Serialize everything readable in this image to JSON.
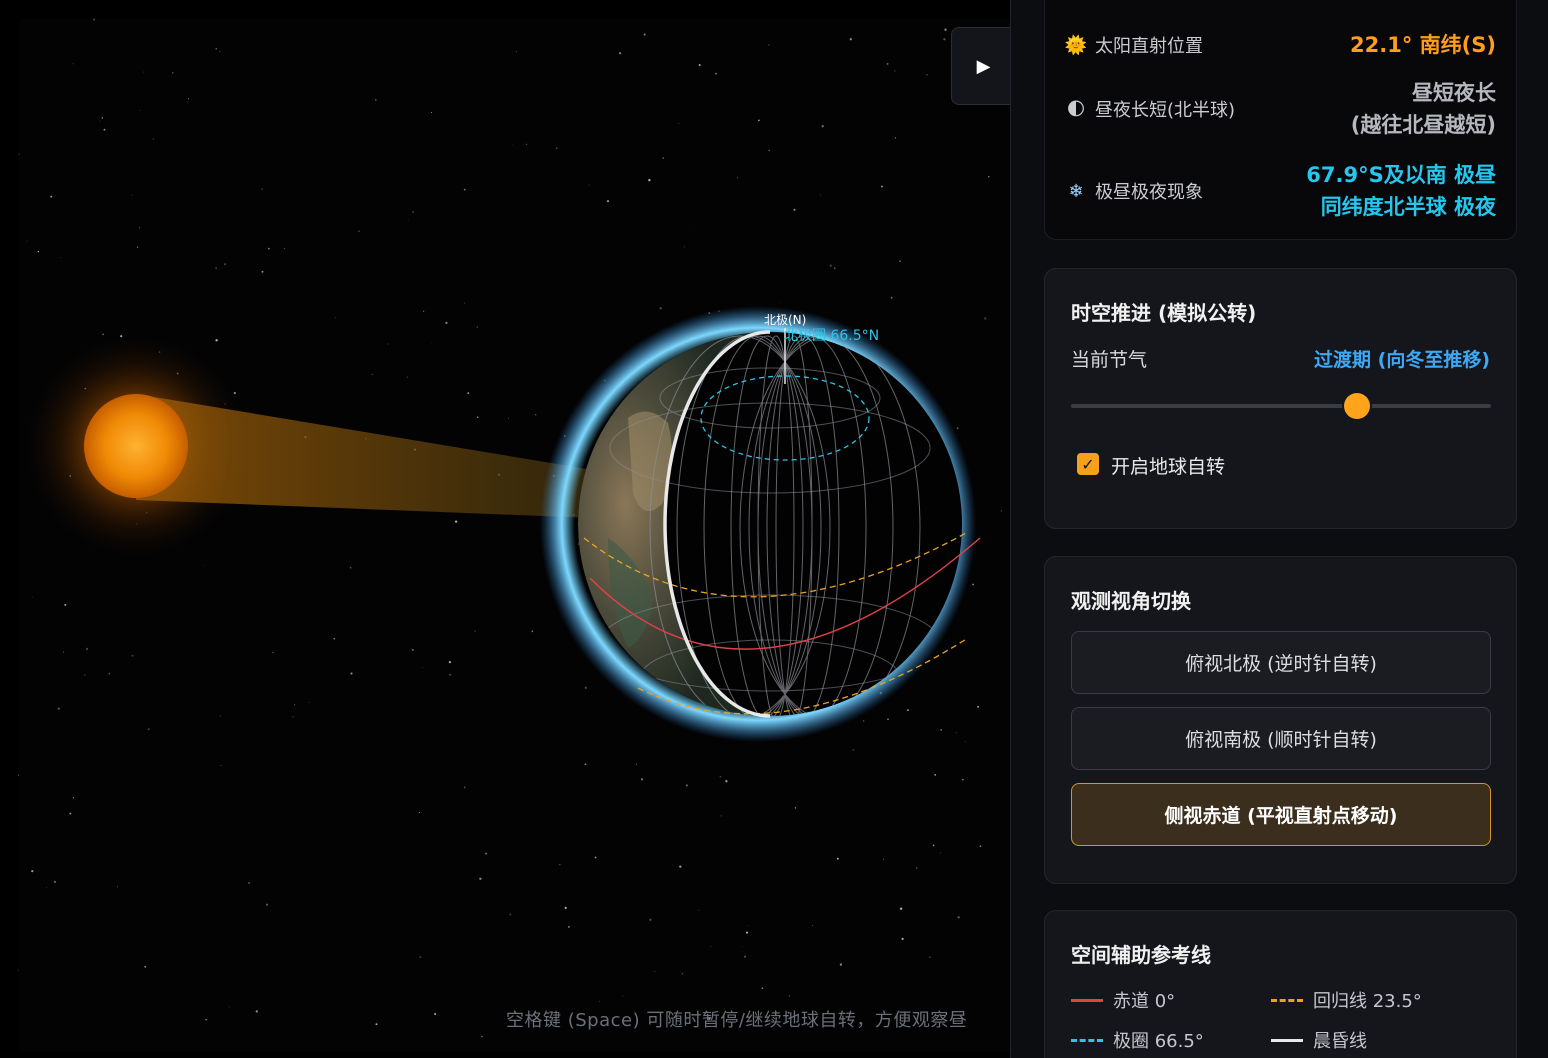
{
  "scene": {
    "north_pole_label": "北极(N)",
    "arctic_circle_label": "北极圈 66.5°N",
    "hint": "空格键 (Space) 可随时暂停/继续地球自转，方便观察昼",
    "colors": {
      "equator": "#e0414b",
      "tropic": "#e8a325",
      "polar_circle": "#2cc4e8",
      "terminator": "#e8e8e8",
      "sun": "#ff8a00"
    }
  },
  "play_button": {
    "icon": "play-icon",
    "glyph": "▶"
  },
  "info": {
    "subsolar": {
      "icon": "sun-icon",
      "glyph": "🌞",
      "label": "太阳直射位置",
      "value": "22.1° 南纬(S)"
    },
    "daylength": {
      "icon": "half-moon-icon",
      "glyph": "🌓",
      "label": "昼夜长短(北半球)",
      "value_line1": "昼短夜长",
      "value_line2": "(越往北昼越短)"
    },
    "polar": {
      "icon": "snowflake-icon",
      "glyph": "❄",
      "label": "极昼极夜现象",
      "value_line1": "67.9°S及以南 极昼",
      "value_line2": "同纬度北半球 极夜"
    }
  },
  "time_panel": {
    "title": "时空推进 (模拟公转)",
    "season_label": "当前节气",
    "season_value": "过渡期 (向冬至推移)",
    "slider_fraction": 0.68,
    "rotate_checked": true,
    "rotate_label": "开启地球自转"
  },
  "view_panel": {
    "title": "观测视角切换",
    "buttons": [
      {
        "label": "俯视北极 (逆时针自转)",
        "active": false
      },
      {
        "label": "俯视南极 (顺时针自转)",
        "active": false
      },
      {
        "label": "侧视赤道 (平视直射点移动)",
        "active": true
      }
    ]
  },
  "ref_panel": {
    "title": "空间辅助参考线",
    "legend": [
      {
        "label": "赤道 0°",
        "color": "#e0414b",
        "style": "solid"
      },
      {
        "label": "回归线 23.5°",
        "color": "#e8a325",
        "style": "dashed"
      },
      {
        "label": "极圈 66.5°",
        "color": "#2cc4e8",
        "style": "dashed"
      },
      {
        "label": "晨昏线",
        "color": "#e8e8e8",
        "style": "solid"
      }
    ]
  }
}
